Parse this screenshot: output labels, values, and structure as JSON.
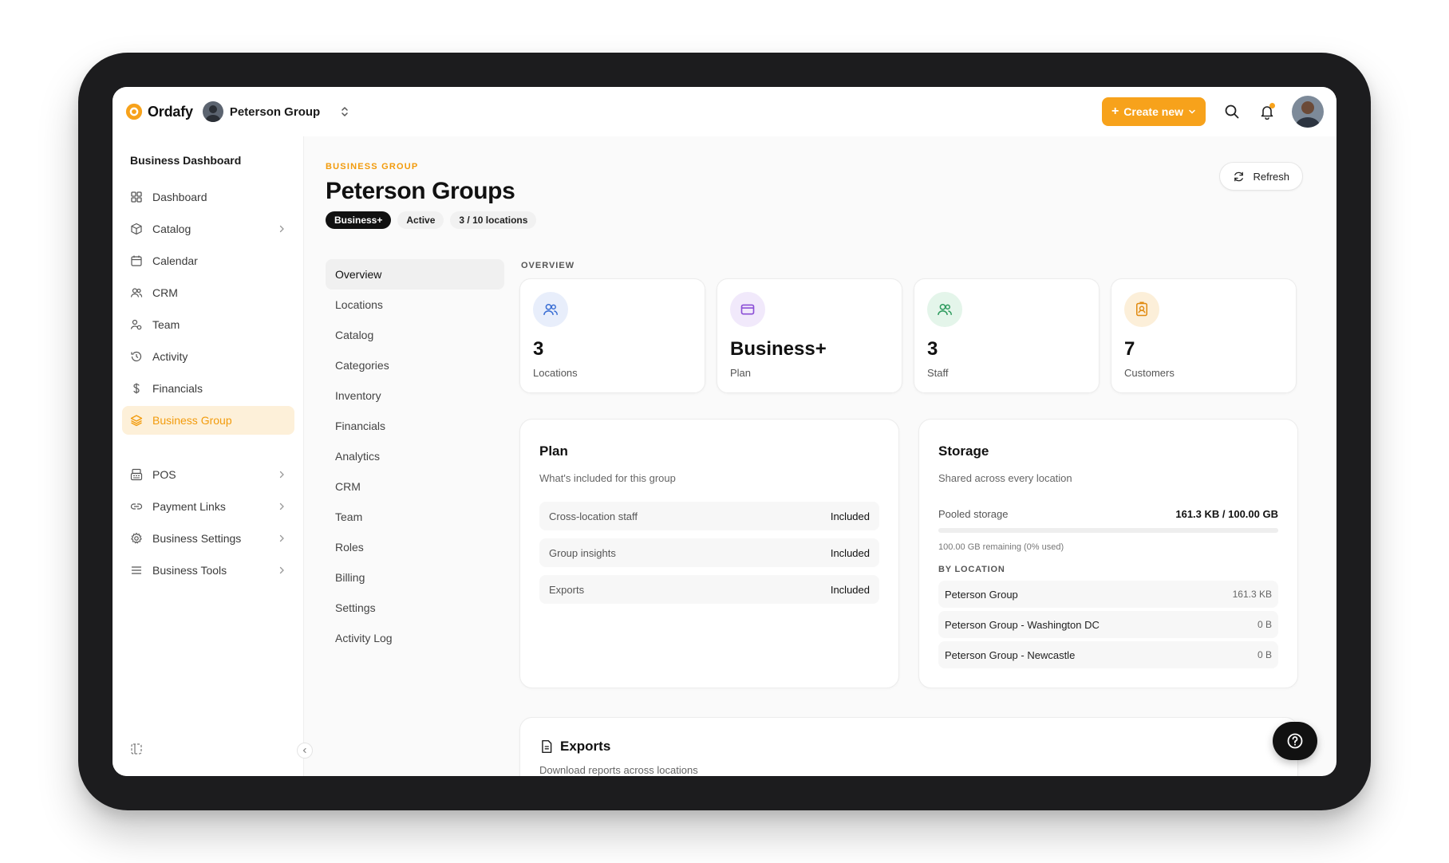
{
  "app": {
    "name": "Ordafy",
    "org_name": "Peterson Group"
  },
  "topbar": {
    "create_label": "Create new"
  },
  "sidebar": {
    "title": "Business Dashboard",
    "items": [
      {
        "label": "Dashboard",
        "icon": "grid-icon"
      },
      {
        "label": "Catalog",
        "icon": "box-icon",
        "chevron": true
      },
      {
        "label": "Calendar",
        "icon": "calendar-icon"
      },
      {
        "label": "CRM",
        "icon": "users-icon"
      },
      {
        "label": "Team",
        "icon": "team-icon"
      },
      {
        "label": "Activity",
        "icon": "history-icon"
      },
      {
        "label": "Financials",
        "icon": "dollar-icon"
      },
      {
        "label": "Business Group",
        "icon": "layers-icon",
        "active": true
      },
      {
        "label": "POS",
        "icon": "register-icon",
        "chevron": true
      },
      {
        "label": "Payment Links",
        "icon": "link-icon",
        "chevron": true
      },
      {
        "label": "Business Settings",
        "icon": "gear-icon",
        "chevron": true
      },
      {
        "label": "Business Tools",
        "icon": "menu-icon",
        "chevron": true
      }
    ]
  },
  "header": {
    "eyebrow": "BUSINESS GROUP",
    "title": "Peterson Groups",
    "badges": [
      "Business+",
      "Active",
      "3 / 10 locations"
    ],
    "refresh_label": "Refresh"
  },
  "subnav": [
    "Overview",
    "Locations",
    "Catalog",
    "Categories",
    "Inventory",
    "Financials",
    "Analytics",
    "CRM",
    "Team",
    "Roles",
    "Billing",
    "Settings",
    "Activity Log"
  ],
  "overview": {
    "label": "OVERVIEW",
    "stats": [
      {
        "value": "3",
        "label": "Locations",
        "icon": "users-icon",
        "color": "#3b6fd4",
        "bg": "#e8eefb"
      },
      {
        "value": "Business+",
        "label": "Plan",
        "icon": "card-icon",
        "color": "#8b4fd6",
        "bg": "#f1e9fb"
      },
      {
        "value": "3",
        "label": "Staff",
        "icon": "users-icon",
        "color": "#2e9b5e",
        "bg": "#e4f5ea"
      },
      {
        "value": "7",
        "label": "Customers",
        "icon": "contact-icon",
        "color": "#e08a10",
        "bg": "#fcefd9"
      }
    ]
  },
  "plan": {
    "title": "Plan",
    "subtitle": "What's included for this group",
    "rows": [
      {
        "label": "Cross-location staff",
        "value": "Included"
      },
      {
        "label": "Group insights",
        "value": "Included"
      },
      {
        "label": "Exports",
        "value": "Included"
      }
    ]
  },
  "storage": {
    "title": "Storage",
    "subtitle": "Shared across every location",
    "pooled_label": "Pooled storage",
    "pooled_value": "161.3 KB / 100.00 GB",
    "used_fraction": 0,
    "remaining": "100.00 GB remaining (0% used)",
    "by_location_label": "BY LOCATION",
    "locations": [
      {
        "name": "Peterson Group",
        "size": "161.3 KB"
      },
      {
        "name": "Peterson Group - Washington DC",
        "size": "0 B"
      },
      {
        "name": "Peterson Group - Newcastle",
        "size": "0 B"
      }
    ]
  },
  "exports": {
    "title": "Exports",
    "subtitle": "Download reports across locations"
  },
  "colors": {
    "accent": "#f7a21b",
    "active_bg": "#fdf0d9",
    "dark": "#111111"
  }
}
